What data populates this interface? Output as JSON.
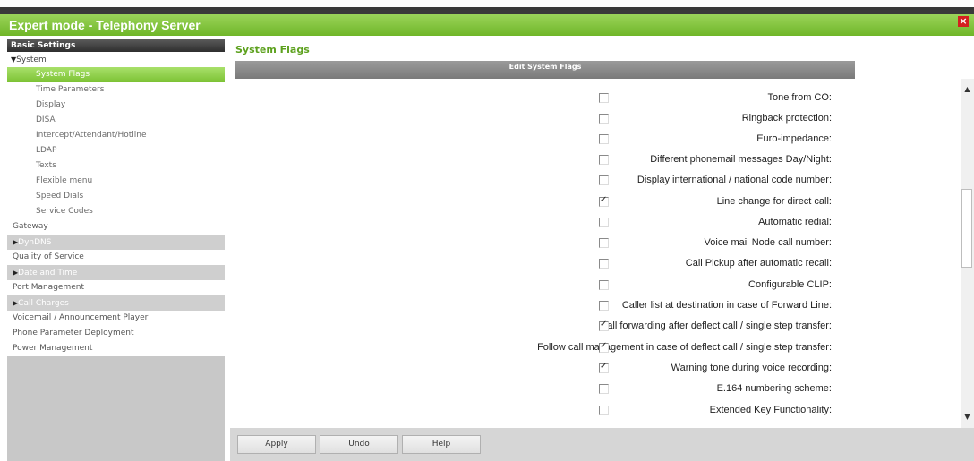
{
  "window": {
    "title": "Expert mode - Telephony Server",
    "close_glyph": "×"
  },
  "sidebar": {
    "header": "Basic Settings",
    "items": [
      {
        "label": "System",
        "type": "open",
        "arrow": "▼"
      },
      {
        "label": "System Flags",
        "type": "sub-active"
      },
      {
        "label": "Time Parameters",
        "type": "sub"
      },
      {
        "label": "Display",
        "type": "sub"
      },
      {
        "label": "DISA",
        "type": "sub"
      },
      {
        "label": "Intercept/Attendant/Hotline",
        "type": "sub"
      },
      {
        "label": "LDAP",
        "type": "sub"
      },
      {
        "label": "Texts",
        "type": "sub"
      },
      {
        "label": "Flexible menu",
        "type": "sub"
      },
      {
        "label": "Speed Dials",
        "type": "sub"
      },
      {
        "label": "Service Codes",
        "type": "sub"
      },
      {
        "label": "Gateway",
        "type": "plain"
      },
      {
        "label": "DynDNS",
        "type": "grey",
        "arrow": "▶"
      },
      {
        "label": "Quality of Service",
        "type": "plain"
      },
      {
        "label": "Date and Time",
        "type": "grey",
        "arrow": "▶"
      },
      {
        "label": "Port Management",
        "type": "plain"
      },
      {
        "label": "Call Charges",
        "type": "grey",
        "arrow": "▶"
      },
      {
        "label": "Voicemail / Announcement Player",
        "type": "plain"
      },
      {
        "label": "Phone Parameter Deployment",
        "type": "plain"
      },
      {
        "label": "Power Management",
        "type": "plain"
      }
    ]
  },
  "main": {
    "title": "System Flags",
    "section_header": "Edit System Flags",
    "flags": [
      {
        "label": "Tone from CO:",
        "checked": false
      },
      {
        "label": "Ringback protection:",
        "checked": false
      },
      {
        "label": "Euro-impedance:",
        "checked": false
      },
      {
        "label": "Different phonemail messages Day/Night:",
        "checked": false
      },
      {
        "label": "Display international / national code number:",
        "checked": false
      },
      {
        "label": "Line change for direct call:",
        "checked": true
      },
      {
        "label": "Automatic redial:",
        "checked": false
      },
      {
        "label": "Voice mail Node call number:",
        "checked": false
      },
      {
        "label": "Call Pickup after automatic recall:",
        "checked": false
      },
      {
        "label": "Configurable CLIP:",
        "checked": false
      },
      {
        "label": "Caller list at destination in case of Forward Line:",
        "checked": false
      },
      {
        "label": "Call forwarding after deflect call / single step transfer:",
        "checked": true
      },
      {
        "label": "Follow call management in case of deflect call / single step transfer:",
        "checked": true
      },
      {
        "label": "Warning tone during voice recording:",
        "checked": true
      },
      {
        "label": "E.164 numbering scheme:",
        "checked": false
      },
      {
        "label": "Extended Key Functionality:",
        "checked": false
      }
    ]
  },
  "footer": {
    "apply_label": "Apply",
    "undo_label": "Undo",
    "help_label": "Help"
  },
  "scrollbar": {
    "up_glyph": "▲",
    "down_glyph": "▼"
  },
  "colors": {
    "accent": "#7cc234",
    "title_green": "#5da11e",
    "header_grey": "#8a8a8a"
  }
}
